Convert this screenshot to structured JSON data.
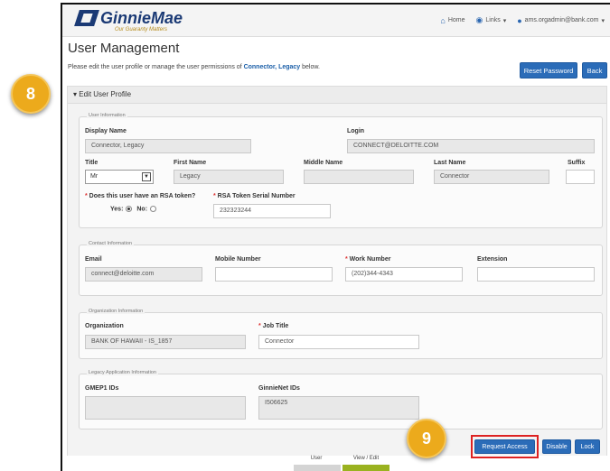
{
  "header": {
    "logo_text": "GinnieMae",
    "logo_tagline": "Our Guaranty Matters",
    "nav": {
      "home": "Home",
      "links": "Links",
      "user": "ams.orgadmin@bank.com"
    }
  },
  "page": {
    "title": "User Management",
    "intro_prefix": "Please edit the user profile or manage the user permissions of ",
    "intro_name": "Connector, Legacy",
    "intro_suffix": " below.",
    "reset_password": "Reset Password",
    "back": "Back",
    "section": "Edit User Profile"
  },
  "user_info": {
    "legend": "User Information",
    "display_name_label": "Display Name",
    "display_name": "Connector, Legacy",
    "login_label": "Login",
    "login": "CONNECT@DELOITTE.COM",
    "title_label": "Title",
    "title_value": "Mr",
    "first_name_label": "First Name",
    "first_name": "Legacy",
    "middle_name_label": "Middle Name",
    "middle_name": "",
    "last_name_label": "Last Name",
    "last_name": "Connector",
    "suffix_label": "Suffix",
    "suffix": "",
    "rsa_question": "Does this user have an RSA token?",
    "yes": "Yes:",
    "no": "No:",
    "rsa_serial_label": "RSA Token Serial Number",
    "rsa_serial": "232323244"
  },
  "contact_info": {
    "legend": "Contact Information",
    "email_label": "Email",
    "email": "connect@deloitte.com",
    "mobile_label": "Mobile Number",
    "mobile": "",
    "work_label": "Work Number",
    "work": "(202)344-4343",
    "ext_label": "Extension",
    "ext": ""
  },
  "org_info": {
    "legend": "Organization Information",
    "org_label": "Organization",
    "org": "BANK OF HAWAII - IS_1857",
    "job_label": "Job Title",
    "job": "Connector"
  },
  "legacy_info": {
    "legend": "Legacy Application Information",
    "gmep_label": "GMEP1 IDs",
    "gmep": "",
    "ginnienet_label": "GinnieNet IDs",
    "ginnienet": "I506625"
  },
  "actions": {
    "request_access": "Request Access",
    "disable": "Disable",
    "lock": "Lock"
  },
  "legend_bar": {
    "user": "User",
    "view_edit": "View / Edit"
  },
  "steps": {
    "step8": "8",
    "step9": "9"
  },
  "colors": {
    "primary": "#2b6cb8",
    "step_badge": "#ecaa1c",
    "highlight": "#d22222"
  }
}
